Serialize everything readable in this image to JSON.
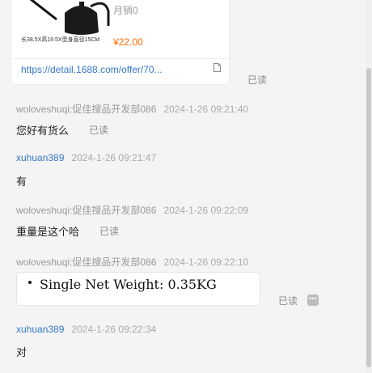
{
  "product": {
    "dims": "长38.5X高19.5X壶身直径15CM",
    "sales": "月销0",
    "price": "¥22.00",
    "link": "https://detail.1688.com/offer/70...",
    "read": "已读"
  },
  "messages": [
    {
      "name": "woloveshuqi:促佳搜品开发部086",
      "time": "2024-1-26 09:21:40",
      "text": "您好有货么",
      "read": "已读"
    },
    {
      "name": "xuhuan389",
      "time": "2024-1-26 09:21:47",
      "text": "有"
    },
    {
      "name": "woloveshuqi:促佳搜品开发部086",
      "time": "2024-1-26 09:22:09",
      "text": "重量是这个哈",
      "read": "已读"
    },
    {
      "name": "woloveshuqi:促佳搜品开发部086",
      "time": "2024-1-26 09:22:10",
      "quote": "Single Net Weight: 0.35KG",
      "read": "已读"
    },
    {
      "name": "xuhuan389",
      "time": "2024-1-26 09:22:34",
      "text": "对"
    }
  ],
  "icons": {
    "copy": "copy-icon",
    "more": "more-icon",
    "product_image": "watering-can-image"
  },
  "colors": {
    "link": "#3478c6",
    "price": "#ff6a00",
    "name_other": "#999999"
  }
}
